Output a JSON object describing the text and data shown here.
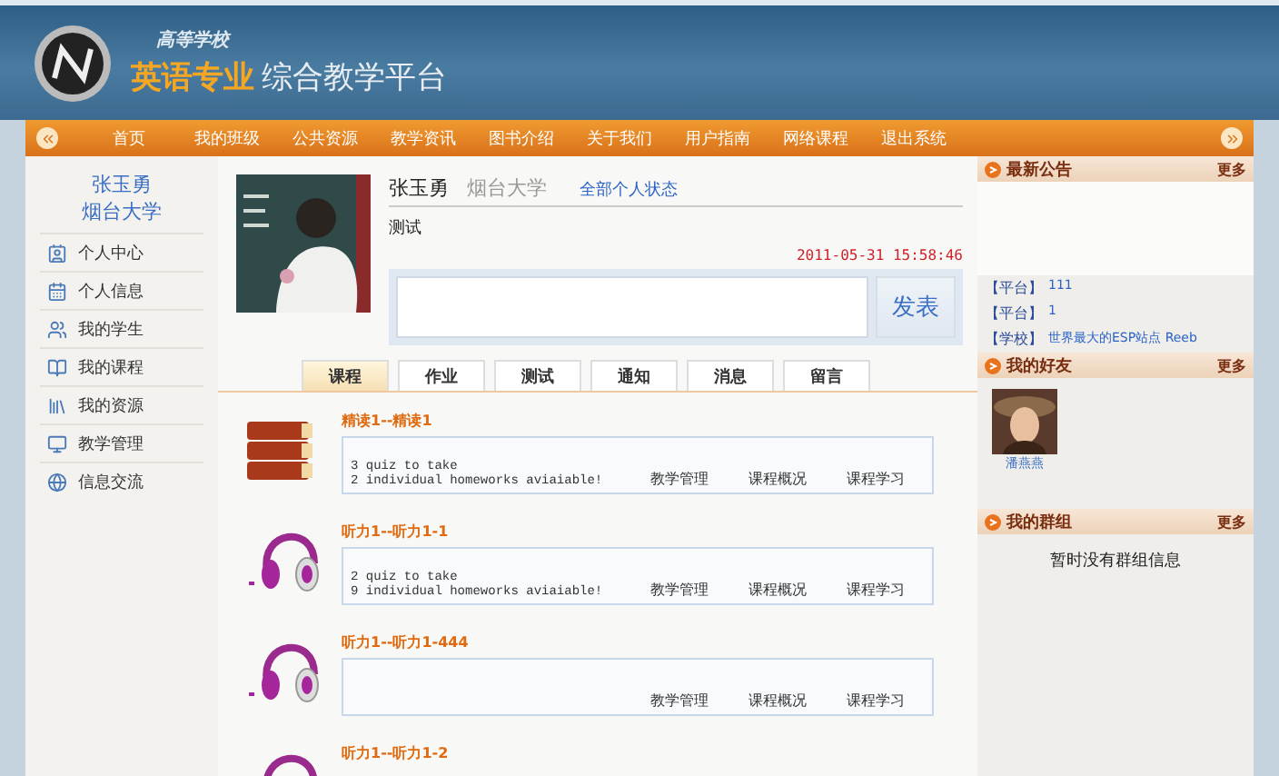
{
  "header": {
    "school": "高等学校",
    "title_highlight": "英语专业",
    "title_rest": "综合教学平台"
  },
  "nav": {
    "items": [
      "首页",
      "我的班级",
      "公共资源",
      "教学资讯",
      "图书介绍",
      "关于我们",
      "用户指南",
      "网络课程",
      "退出系统"
    ]
  },
  "sidebar": {
    "name": "张玉勇",
    "school": "烟台大学",
    "items": [
      "个人中心",
      "个人信息",
      "我的学生",
      "我的课程",
      "我的资源",
      "教学管理",
      "信息交流"
    ]
  },
  "profile": {
    "name": "张玉勇",
    "school": "烟台大学",
    "all_status_link": "全部个人状态",
    "status": "测试",
    "time": "2011-05-31 15:58:46",
    "post_button": "发表"
  },
  "tabs": [
    {
      "label": "课程",
      "selected": true
    },
    {
      "label": "作业",
      "selected": false
    },
    {
      "label": "测试",
      "selected": false
    },
    {
      "label": "通知",
      "selected": false
    },
    {
      "label": "消息",
      "selected": false
    },
    {
      "label": "留言",
      "selected": false
    }
  ],
  "courses": [
    {
      "kind": "book",
      "title": "精读1--精读1",
      "lines": [
        "3 quiz to take",
        "2 individual homeworks aviaiable!"
      ],
      "links": [
        "教学管理",
        "课程概况",
        "课程学习"
      ]
    },
    {
      "kind": "headphones",
      "title": "听力1--听力1-1",
      "lines": [
        "2 quiz to take",
        "9 individual homeworks aviaiable!"
      ],
      "links": [
        "教学管理",
        "课程概况",
        "课程学习"
      ]
    },
    {
      "kind": "headphones",
      "title": "听力1--听力1-444",
      "links": [
        "教学管理",
        "课程概况",
        "课程学习"
      ]
    },
    {
      "kind": "headphones",
      "title": "听力1--听力1-2"
    }
  ],
  "announcements": {
    "title": "最新公告",
    "more": "更多",
    "items": [
      {
        "tag": "【平台】",
        "text": "111"
      },
      {
        "tag": "【平台】",
        "text": "1"
      },
      {
        "tag": "【学校】",
        "text": "世界最大的ESP站点 Reeb"
      }
    ]
  },
  "friends": {
    "title": "我的好友",
    "more": "更多",
    "items": [
      {
        "name": "潘燕燕"
      }
    ]
  },
  "groups": {
    "title": "我的群组",
    "more": "更多",
    "empty": "暂时没有群组信息"
  }
}
